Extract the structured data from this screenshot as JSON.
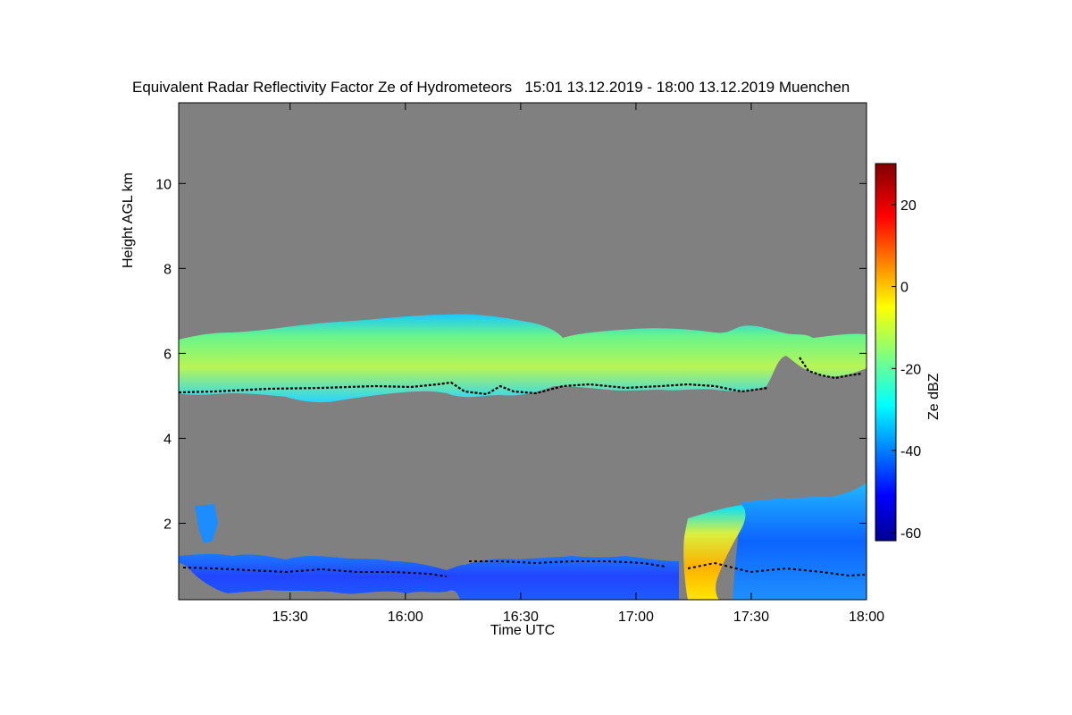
{
  "chart_data": {
    "type": "heatmap",
    "title": "Equivalent Radar Reflectivity Factor Ze of Hydrometeors   15:01 13.12.2019 - 18:00 13.12.2019 Muenchen",
    "xlabel": "Time UTC",
    "ylabel": "Height AGL km",
    "colorbar_label": "Ze dBZ",
    "xlim_minutes_utc": [
      901,
      1080
    ],
    "ylim": [
      0.2,
      11.9
    ],
    "x_ticks": [
      {
        "value": 930,
        "label": "15:30"
      },
      {
        "value": 960,
        "label": "16:00"
      },
      {
        "value": 990,
        "label": "16:30"
      },
      {
        "value": 1020,
        "label": "17:00"
      },
      {
        "value": 1050,
        "label": "17:30"
      },
      {
        "value": 1080,
        "label": "18:00"
      }
    ],
    "y_ticks": [
      2,
      4,
      6,
      8,
      10
    ],
    "colorbar_range": [
      -62,
      30
    ],
    "colorbar_ticks": [
      20,
      0,
      -20,
      -40,
      -60
    ],
    "colormap": "jet",
    "background_color": "#808080",
    "layers": [
      {
        "name": "upper cloud layer",
        "time_range": [
          "15:01",
          "18:00"
        ],
        "base_km": 5.1,
        "top_km": 6.9,
        "typical_ze_dbz": -15
      },
      {
        "name": "low precipitation layer",
        "time_range": [
          "15:01",
          "18:00"
        ],
        "base_km": 0.2,
        "top_km": 1.3,
        "typical_ze_dbz": -45
      },
      {
        "name": "enhanced echo",
        "time_range": [
          "17:12",
          "17:25"
        ],
        "base_km": 0.2,
        "top_km": 2.4,
        "typical_ze_dbz": -5
      },
      {
        "name": "upper feature late",
        "time_range": [
          "17:25",
          "18:00"
        ],
        "base_km": 0.2,
        "top_km": 2.9,
        "typical_ze_dbz": -40
      }
    ],
    "cloud_base_line": [
      {
        "t": "15:01",
        "h": 5.1
      },
      {
        "t": "15:30",
        "h": 5.25
      },
      {
        "t": "16:00",
        "h": 5.25
      },
      {
        "t": "16:10",
        "h": 5.3
      },
      {
        "t": "16:20",
        "h": 5.1
      },
      {
        "t": "16:25",
        "h": 5.3
      },
      {
        "t": "16:35",
        "h": 5.1
      },
      {
        "t": "16:45",
        "h": 5.3
      },
      {
        "t": "17:00",
        "h": 5.25
      },
      {
        "t": "17:20",
        "h": 5.3
      },
      {
        "t": "17:35",
        "h": 5.2
      },
      {
        "t": "17:45",
        "h": 5.7
      },
      {
        "t": "17:50",
        "h": 5.5
      },
      {
        "t": "18:00",
        "h": 5.7
      }
    ]
  }
}
